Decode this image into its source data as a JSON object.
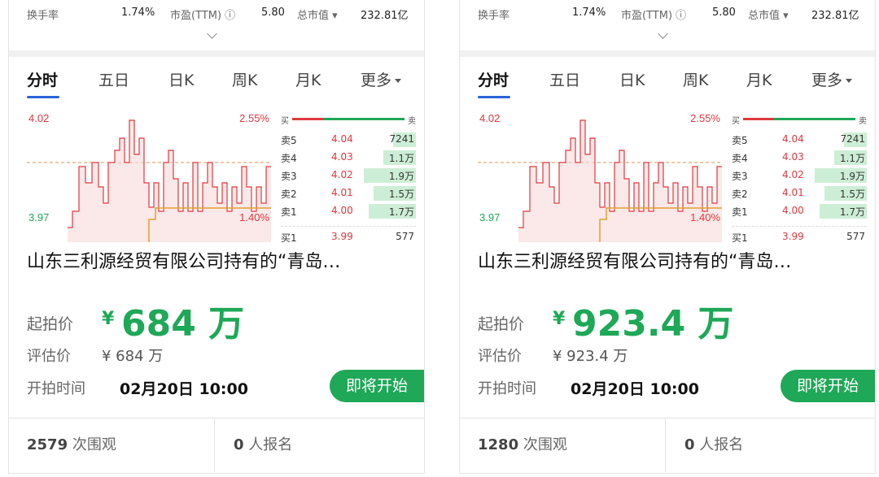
{
  "quote": {
    "turnover_label": "换手率",
    "turnover_value": "1.74%",
    "pe_label": "市盈(TTM) ⓘ",
    "pe_value": "5.80",
    "mcap_label": "总市值 ▾",
    "mcap_value": "232.81亿"
  },
  "tabs": [
    "分时",
    "五日",
    "日K",
    "周K",
    "月K",
    "更多"
  ],
  "chart": {
    "price_high": "4.02",
    "price_low": "3.97",
    "pct_high": "2.55%",
    "pct_low": "1.40%"
  },
  "orderbook": {
    "buy_label": "买",
    "sell_label": "卖",
    "rows": [
      {
        "label": "卖5",
        "price": "4.04",
        "vol": "7241"
      },
      {
        "label": "卖4",
        "price": "4.03",
        "vol": "1.1万"
      },
      {
        "label": "卖3",
        "price": "4.02",
        "vol": "1.9万"
      },
      {
        "label": "卖2",
        "price": "4.01",
        "vol": "1.5万"
      },
      {
        "label": "卖1",
        "price": "4.00",
        "vol": "1.7万"
      },
      {
        "label": "买1",
        "price": "3.99",
        "vol": "577"
      }
    ]
  },
  "cards": [
    {
      "title": "山东三利源经贸有限公司持有的“青岛…",
      "start_label": "起拍价",
      "currency": "¥",
      "start_price": "684 万",
      "est_label": "评估价",
      "est_value": "¥ 684 万",
      "time_label": "开拍时间",
      "time_value": "02月20日 10:00",
      "badge": "即将开始",
      "views_count": "2579",
      "views_label": "次围观",
      "signup_count": "0",
      "signup_label": "人报名"
    },
    {
      "title": "山东三利源经贸有限公司持有的“青岛…",
      "start_label": "起拍价",
      "currency": "¥",
      "start_price": "923.4 万",
      "est_label": "评估价",
      "est_value": "¥ 923.4 万",
      "time_label": "开拍时间",
      "time_value": "02月20日 10:00",
      "badge": "即将开始",
      "views_count": "1280",
      "views_label": "次围观",
      "signup_count": "0",
      "signup_label": "人报名"
    }
  ],
  "colors": {
    "accent_green": "#1ea857",
    "price_red": "#e0383e",
    "tab_indicator": "#2b63d9"
  }
}
